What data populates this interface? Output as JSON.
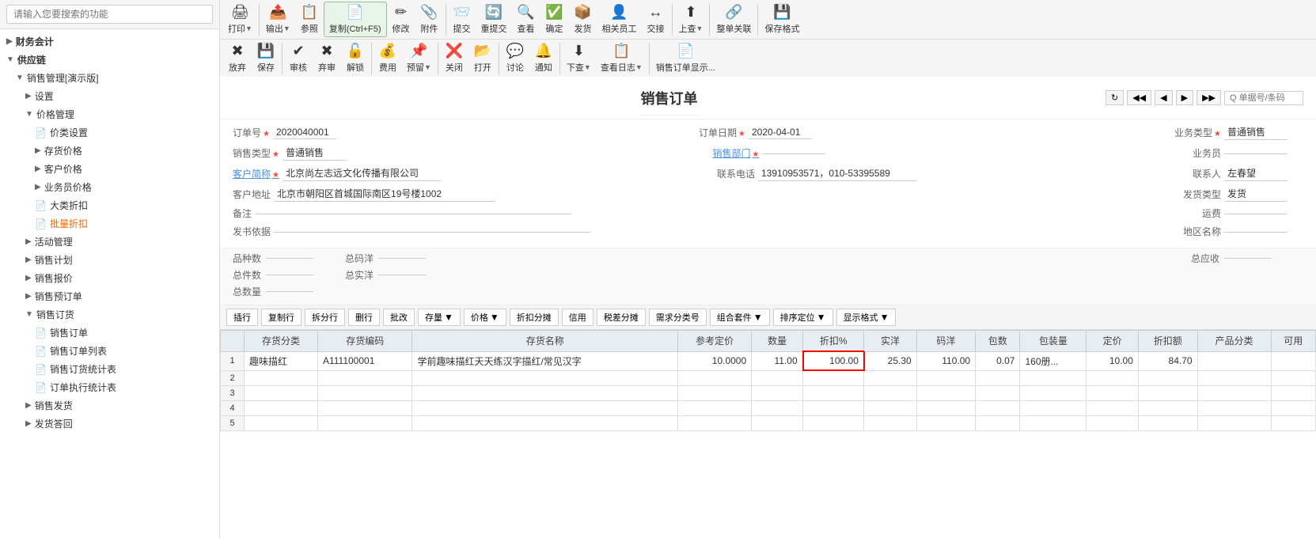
{
  "sidebar": {
    "search_placeholder": "请输入您要搜索的功能",
    "items": [
      {
        "id": "accounting",
        "label": "财务会计",
        "level": 0,
        "arrow": "▶",
        "expanded": false
      },
      {
        "id": "supply",
        "label": "供应链",
        "level": 0,
        "arrow": "▼",
        "expanded": true
      },
      {
        "id": "sales-mgmt",
        "label": "销售管理[演示版]",
        "level": 1,
        "arrow": "▼",
        "expanded": true
      },
      {
        "id": "settings",
        "label": "设置",
        "level": 2,
        "arrow": "▶",
        "expanded": false
      },
      {
        "id": "price-mgmt",
        "label": "价格管理",
        "level": 2,
        "arrow": "▼",
        "expanded": true
      },
      {
        "id": "price-category",
        "label": "价类设置",
        "level": 3,
        "icon": "doc",
        "expanded": false
      },
      {
        "id": "stock-price",
        "label": "存货价格",
        "level": 3,
        "arrow": "▶",
        "expanded": false
      },
      {
        "id": "customer-price",
        "label": "客户价格",
        "level": 3,
        "arrow": "▶",
        "expanded": false
      },
      {
        "id": "staff-price",
        "label": "业务员价格",
        "level": 3,
        "arrow": "▶",
        "expanded": false
      },
      {
        "id": "bulk-discount",
        "label": "大类折扣",
        "level": 3,
        "icon": "doc",
        "expanded": false
      },
      {
        "id": "batch-discount",
        "label": "批量折扣",
        "level": 3,
        "icon": "doc",
        "expanded": false,
        "active": true
      },
      {
        "id": "activity-mgmt",
        "label": "活动管理",
        "level": 2,
        "arrow": "▶",
        "expanded": false
      },
      {
        "id": "sales-plan",
        "label": "销售计划",
        "level": 2,
        "arrow": "▶",
        "expanded": false
      },
      {
        "id": "sales-quote",
        "label": "销售报价",
        "level": 2,
        "arrow": "▶",
        "expanded": false
      },
      {
        "id": "sales-preorder",
        "label": "销售预订单",
        "level": 2,
        "arrow": "▶",
        "expanded": false
      },
      {
        "id": "sales-order",
        "label": "销售订货",
        "level": 2,
        "arrow": "▼",
        "expanded": true
      },
      {
        "id": "sales-order-list",
        "label": "销售订单",
        "level": 3,
        "icon": "doc",
        "expanded": false
      },
      {
        "id": "sales-order-list2",
        "label": "销售订单列表",
        "level": 3,
        "icon": "doc",
        "expanded": false
      },
      {
        "id": "sales-order-stats",
        "label": "销售订货统计表",
        "level": 3,
        "icon": "doc",
        "expanded": false
      },
      {
        "id": "order-exec-stats",
        "label": "订单执行统计表",
        "level": 3,
        "icon": "doc",
        "expanded": false
      },
      {
        "id": "sales-delivery",
        "label": "销售发货",
        "level": 2,
        "arrow": "▶",
        "expanded": false
      },
      {
        "id": "delivery-back",
        "label": "发货答回",
        "level": 2,
        "arrow": "▶",
        "expanded": false
      }
    ]
  },
  "toolbar": {
    "row1": {
      "buttons": [
        {
          "id": "print",
          "label": "打印",
          "icon": "🖨",
          "has_arrow": true
        },
        {
          "id": "export",
          "label": "输出",
          "icon": "📤",
          "has_arrow": true
        },
        {
          "id": "reference",
          "label": "参照",
          "icon": "📋"
        },
        {
          "id": "copy",
          "label": "复制(Ctrl+F5)",
          "icon": "📄"
        },
        {
          "id": "modify",
          "label": "修改",
          "icon": "✏"
        },
        {
          "id": "attach",
          "label": "附件",
          "icon": "📎"
        },
        {
          "id": "submit",
          "label": "提交",
          "icon": "📨"
        },
        {
          "id": "resubmit",
          "label": "重提交",
          "icon": "🔄"
        },
        {
          "id": "check",
          "label": "查看",
          "icon": "🔍"
        },
        {
          "id": "confirm",
          "label": "确定",
          "icon": "✅"
        },
        {
          "id": "invoice",
          "label": "发货",
          "icon": "📦"
        },
        {
          "id": "related-staff",
          "label": "相关员工",
          "icon": "👤"
        },
        {
          "id": "transfer",
          "label": "交接",
          "icon": "↔"
        },
        {
          "id": "previous",
          "label": "上查",
          "icon": "⬆",
          "has_arrow": true
        },
        {
          "id": "whole-order",
          "label": "整单关联",
          "icon": "🔗"
        },
        {
          "id": "format-save",
          "label": "保存格式",
          "icon": "💾"
        }
      ]
    },
    "row2": {
      "buttons": [
        {
          "id": "abandon",
          "label": "放弃",
          "icon": "✖"
        },
        {
          "id": "save",
          "label": "保存",
          "icon": "💾"
        },
        {
          "id": "review",
          "label": "审核",
          "icon": "✔"
        },
        {
          "id": "abandon2",
          "label": "弃审",
          "icon": "✖"
        },
        {
          "id": "unlock",
          "label": "解锁",
          "icon": "🔓"
        },
        {
          "id": "fee",
          "label": "费用",
          "icon": "💰"
        },
        {
          "id": "prebook",
          "label": "预留",
          "icon": "📌",
          "has_arrow": true
        },
        {
          "id": "close",
          "label": "关闭",
          "icon": "❌"
        },
        {
          "id": "open",
          "label": "打开",
          "icon": "📂"
        },
        {
          "id": "discuss",
          "label": "讨论",
          "icon": "💬"
        },
        {
          "id": "notify",
          "label": "通知",
          "icon": "🔔"
        },
        {
          "id": "down-check",
          "label": "下查",
          "icon": "⬇",
          "has_arrow": true
        },
        {
          "id": "view-log",
          "label": "查看日志",
          "icon": "📋",
          "has_arrow": true
        },
        {
          "id": "order-detail",
          "label": "销售订单显示...",
          "icon": "📄"
        }
      ]
    }
  },
  "form": {
    "title": "销售订单",
    "nav": {
      "refresh": "↻",
      "first": "◀◀",
      "prev": "◀",
      "next": "▶",
      "last": "▶▶",
      "search_label": "Q 单据号/条码"
    },
    "fields": {
      "order_no_label": "订单号",
      "order_no": "2020040001",
      "order_date_label": "订单日期",
      "order_date": "2020-04-01",
      "biz_type_label": "业务类型",
      "biz_type": "普通销售",
      "sales_type_label": "销售类型",
      "sales_type": "普通销售",
      "sales_dept_label": "销售部门",
      "sales_dept": "",
      "staff_label": "业务员",
      "staff": "",
      "customer_label": "客户简称",
      "customer": "北京尚左志远文化传播有限公司",
      "phone_label": "联系电话",
      "phone": "13910953571，010-53395589",
      "contact_label": "联系人",
      "contact": "左春望",
      "customer_addr_label": "客户地址",
      "customer_addr": "北京市朝阳区首城国际南区19号楼1002",
      "delivery_type_label": "发货类型",
      "delivery_type": "发货",
      "remark_label": "备注",
      "remark": "",
      "freight_label": "运费",
      "freight": "",
      "basis_label": "发书依据",
      "basis": "",
      "region_label": "地区名称",
      "region": ""
    },
    "summary": {
      "variety_count_label": "品种数",
      "variety_count": "",
      "total_ocean_label": "总码洋",
      "total_ocean": "",
      "total_receivable_label": "总应收",
      "total_receivable": "",
      "total_pieces_label": "总件数",
      "total_pieces": "",
      "total_actual_label": "总实洋",
      "total_actual": "",
      "total_qty_label": "总数量",
      "total_qty": ""
    }
  },
  "table": {
    "toolbar_buttons": [
      {
        "id": "insert",
        "label": "插行"
      },
      {
        "id": "copy-row",
        "label": "复制行"
      },
      {
        "id": "split-row",
        "label": "拆分行"
      },
      {
        "id": "delete-row",
        "label": "删行"
      },
      {
        "id": "batch-modify",
        "label": "批改"
      },
      {
        "id": "stock",
        "label": "存量",
        "has_arrow": true
      },
      {
        "id": "price",
        "label": "价格",
        "has_arrow": true
      },
      {
        "id": "discount-split",
        "label": "折扣分摊"
      },
      {
        "id": "credit",
        "label": "信用"
      },
      {
        "id": "tax-diff",
        "label": "税差分摊"
      },
      {
        "id": "demand-no",
        "label": "需求分类号"
      },
      {
        "id": "combo",
        "label": "组合套件",
        "has_arrow": true
      },
      {
        "id": "sort",
        "label": "排序定位",
        "has_arrow": true
      },
      {
        "id": "display",
        "label": "显示格式",
        "has_arrow": true
      }
    ],
    "columns": [
      {
        "id": "stock-type",
        "label": "存货分类"
      },
      {
        "id": "stock-code",
        "label": "存货编码"
      },
      {
        "id": "stock-name",
        "label": "存货名称"
      },
      {
        "id": "ref-price",
        "label": "参考定价"
      },
      {
        "id": "qty",
        "label": "数量"
      },
      {
        "id": "discount",
        "label": "折扣%"
      },
      {
        "id": "actual-price",
        "label": "实洋"
      },
      {
        "id": "ocean",
        "label": "码洋"
      },
      {
        "id": "packages",
        "label": "包数"
      },
      {
        "id": "pkg-qty",
        "label": "包装量"
      },
      {
        "id": "list-price",
        "label": "定价"
      },
      {
        "id": "discount-amount",
        "label": "折扣额"
      },
      {
        "id": "product-type",
        "label": "产品分类"
      },
      {
        "id": "available",
        "label": "可用"
      }
    ],
    "rows": [
      {
        "row_no": "1",
        "stock_type": "趣味描红",
        "stock_code": "A111100001",
        "stock_name": "学前趣味描红天天练汉字描红/常见汉字",
        "ref_price": "10.0000",
        "qty": "11.00",
        "discount": "100.00",
        "actual_price": "25.30",
        "ocean": "110.00",
        "packages": "0.07",
        "pkg_qty": "160册...",
        "list_price": "10.00",
        "discount_amount": "84.70",
        "product_type": "",
        "available": ""
      },
      {
        "row_no": "2",
        "stock_type": "",
        "stock_code": "",
        "stock_name": "",
        "ref_price": "",
        "qty": "",
        "discount": "",
        "actual_price": "",
        "ocean": "",
        "packages": "",
        "pkg_qty": "",
        "list_price": "",
        "discount_amount": "",
        "product_type": "",
        "available": ""
      },
      {
        "row_no": "3",
        "stock_type": "",
        "stock_code": "",
        "stock_name": "",
        "ref_price": "",
        "qty": "",
        "discount": "",
        "actual_price": "",
        "ocean": "",
        "packages": "",
        "pkg_qty": "",
        "list_price": "",
        "discount_amount": "",
        "product_type": "",
        "available": ""
      },
      {
        "row_no": "4",
        "stock_type": "",
        "stock_code": "",
        "stock_name": "",
        "ref_price": "",
        "qty": "",
        "discount": "",
        "actual_price": "",
        "ocean": "",
        "packages": "",
        "pkg_qty": "",
        "list_price": "",
        "discount_amount": "",
        "product_type": "",
        "available": ""
      },
      {
        "row_no": "5",
        "stock_type": "",
        "stock_code": "",
        "stock_name": "",
        "ref_price": "",
        "qty": "",
        "discount": "",
        "actual_price": "",
        "ocean": "",
        "packages": "",
        "pkg_qty": "",
        "list_price": "",
        "discount_amount": "",
        "product_type": "",
        "available": ""
      }
    ]
  },
  "colors": {
    "accent": "#4a90d9",
    "required_star": "#ff4444",
    "highlight_border": "#ff0000",
    "header_bg": "#e8edf2",
    "toolbar_bg": "#f5f5f5",
    "active_text": "#ff6600"
  }
}
